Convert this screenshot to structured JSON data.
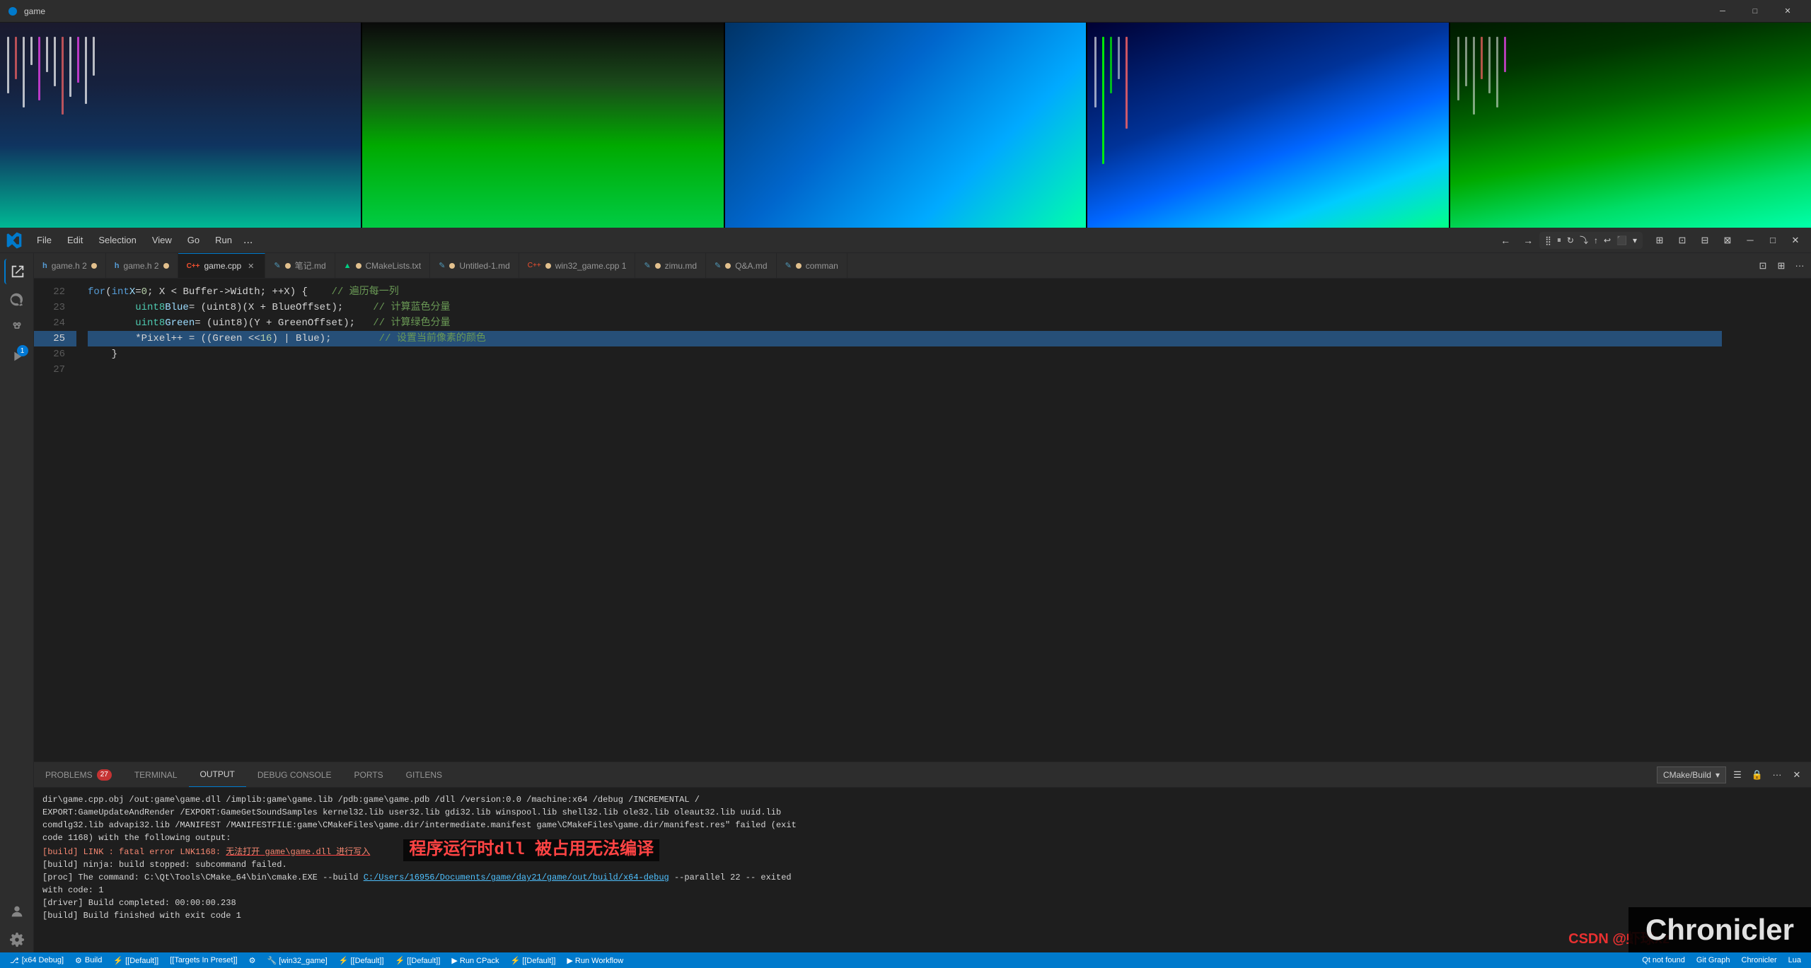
{
  "titleBar": {
    "title": "game",
    "icon": "●",
    "minimize": "─",
    "maximize": "□",
    "close": "✕"
  },
  "gameArea": {
    "panels": [
      {
        "id": "panel1",
        "type": "dark-blue-green"
      },
      {
        "id": "panel2",
        "type": "dark-to-green"
      },
      {
        "id": "panel3",
        "type": "blue-teal"
      },
      {
        "id": "panel4",
        "type": "dark-blue-cyan-green"
      },
      {
        "id": "panel5",
        "type": "dark-green"
      }
    ]
  },
  "menuBar": {
    "items": [
      "File",
      "Edit",
      "Selection",
      "View",
      "Go",
      "Run",
      "..."
    ],
    "file_label": "File",
    "edit_label": "Edit",
    "selection_label": "Selection",
    "view_label": "View",
    "go_label": "Go",
    "run_label": "Run",
    "dots_label": "..."
  },
  "tabs": [
    {
      "label": "game.h 2",
      "icon": "h",
      "color": "#569cd6",
      "active": false,
      "modified": true,
      "dot": false
    },
    {
      "label": "game.h 2",
      "icon": "h",
      "color": "#569cd6",
      "active": false,
      "modified": true,
      "dot": false
    },
    {
      "label": "game.cpp",
      "icon": "C++",
      "color": "#f1502f",
      "active": true,
      "modified": false,
      "dot": false
    },
    {
      "label": "笔记.md",
      "icon": "M",
      "color": "#519aba",
      "active": false,
      "modified": true,
      "dot": false
    },
    {
      "label": "CMakeLists.txt",
      "icon": "▲",
      "color": "#00d084",
      "active": false,
      "modified": true,
      "dot": false
    },
    {
      "label": "Untitled-1.md",
      "icon": "M",
      "color": "#519aba",
      "active": false,
      "modified": true,
      "dot": false
    },
    {
      "label": "win32_game.cpp 1",
      "icon": "C++",
      "color": "#f1502f",
      "active": false,
      "modified": true,
      "dot": false
    },
    {
      "label": "zimu.md",
      "icon": "M",
      "color": "#519aba",
      "active": false,
      "modified": true,
      "dot": false
    },
    {
      "label": "Q&A.md",
      "icon": "M",
      "color": "#519aba",
      "active": false,
      "modified": true,
      "dot": false
    },
    {
      "label": "comman",
      "icon": "M",
      "color": "#519aba",
      "active": false,
      "modified": true,
      "dot": false
    }
  ],
  "codeLines": [
    {
      "num": "22",
      "content": "    for (int X = 0; X < Buffer->Width; ++X) {    // 遍历每一列"
    },
    {
      "num": "23",
      "content": "        uint8 Blue = (uint8)(X + BlueOffset);     // 计算蓝色分量"
    },
    {
      "num": "24",
      "content": "        uint8 Green = (uint8)(Y + GreenOffset);   // 计算绿色分量"
    },
    {
      "num": "25",
      "content": "        *Pixel++ = ((Green << 16) | Blue);        // 设置当前像素的颜色"
    },
    {
      "num": "26",
      "content": "    }"
    }
  ],
  "panelTabs": {
    "problems": "PROBLEMS",
    "problemsBadge": "27",
    "terminal": "TERMINAL",
    "output": "OUTPUT",
    "debugConsole": "DEBUG CONSOLE",
    "ports": "PORTS",
    "gitLens": "GITLENS",
    "activeTab": "OUTPUT"
  },
  "outputDropdown": "CMake/Build",
  "outputLines": [
    "dir\\game.cpp.obj /out:game\\game.dll /implib:game\\game.lib /pdb:game\\game.pdb /dll /version:0.0 /machine:x64 /debug /INCREMENTAL /",
    "EXPORT:GameUpdateAndRender /EXPORT:GameGetSoundSamples kernel32.lib user32.lib gdi32.lib winspool.lib shell32.lib ole32.lib oleaut32.lib uuid.lib",
    "comdlg32.lib advapi32.lib /MANIFEST /MANIFESTFILE:game\\CMakeFiles\\game.dir/intermediate.manifest game\\CMakeFiles\\game.dir/manifest.res\" failed (exit",
    "code 1168) with the following output:",
    "[build] LINK : fatal error LNK1168: 无法打开 game\\game.dll 进行写入",
    "[build] ninja: build stopped: subcommand failed.",
    "[proc] The command: C:\\Qt\\Tools\\CMake_64\\bin\\cmake.EXE --build C:/Users/16956/Documents/game/day21/game/out/build/x64-debug --parallel 22 -- exited",
    "with code: 1",
    "[driver] Build completed: 00:00:00.238",
    "[build] Build finished with exit code 1"
  ],
  "annotation": {
    "text": "程序运行时dll 被占用无法编译",
    "underlined": "无法打开 game\\game.dll 进行写入"
  },
  "statusBar": {
    "gitBranch": "⎇ [x64 Debug]",
    "build": "Build",
    "default1": "⚡ [[Default]]",
    "targets": "[[Targets In Preset]]",
    "gear": "⚙",
    "win32game": "🔧 [win32_game]",
    "default2": "⚡ [[Default]]",
    "default3": "⚡ [[Default]]",
    "runCPack": "▶ Run CPack",
    "default4": "⚡ [[Default]]",
    "runWorkflow": "▶ Run Workflow",
    "qtNotFound": "Qt not found",
    "gitGraph": "Git Graph",
    "chronicler": "Chronicler",
    "lua": "Lua"
  },
  "watermark": {
    "csdn": "CSDN @虾球xz",
    "chronicler": "Chronicler"
  }
}
